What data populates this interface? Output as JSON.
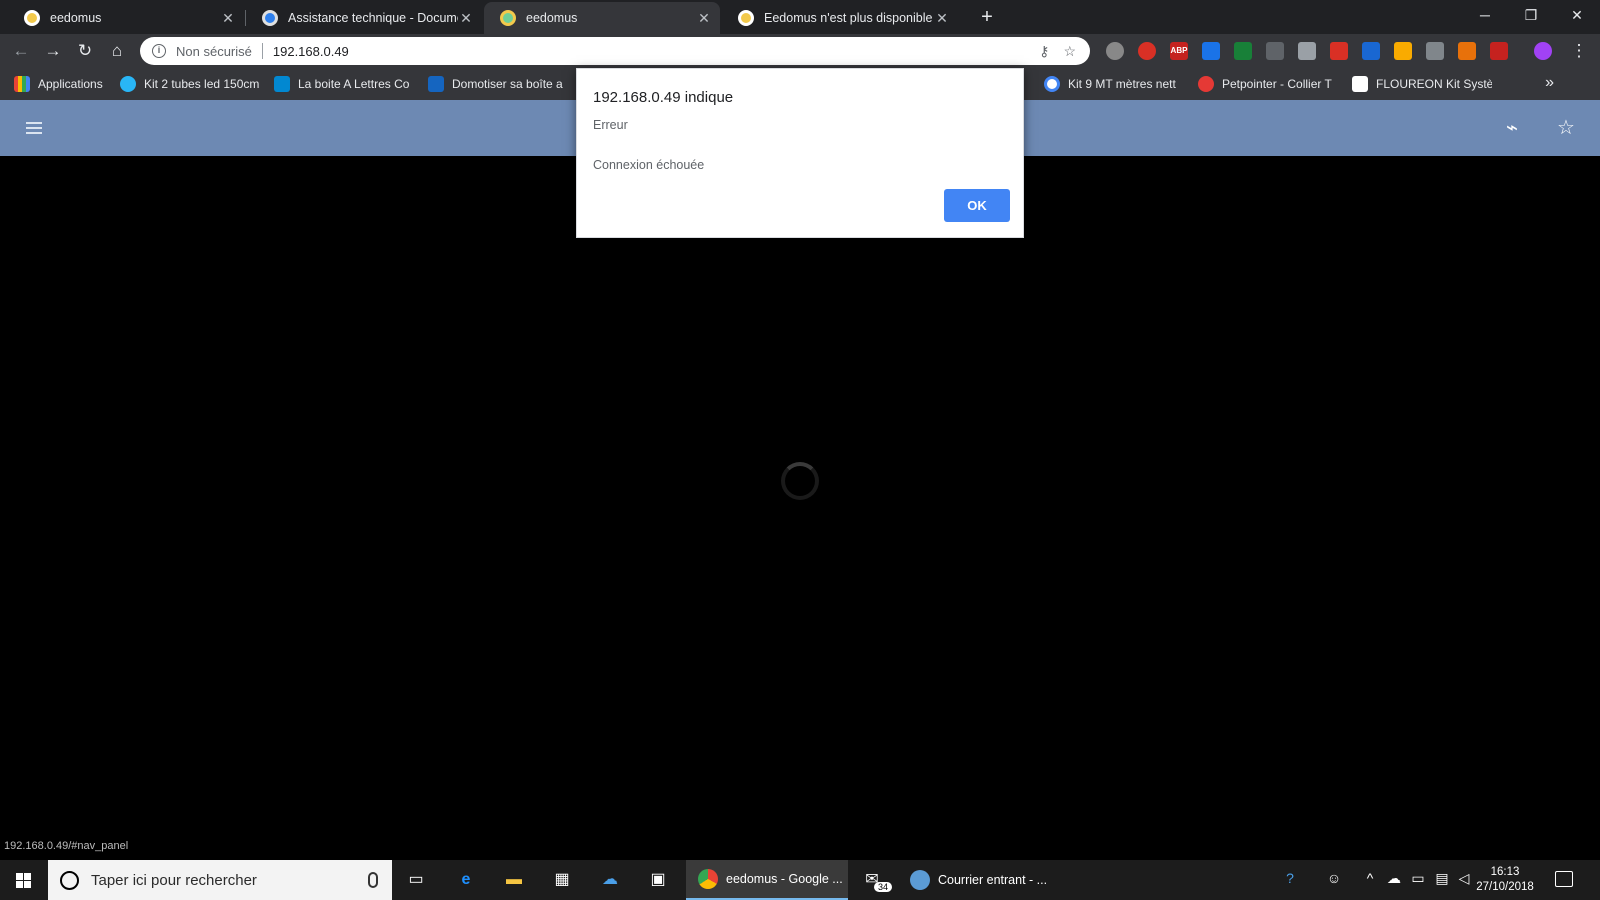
{
  "browser": {
    "tabs": [
      {
        "title": "eedomus",
        "active": false
      },
      {
        "title": "Assistance technique - Documen",
        "active": false
      },
      {
        "title": "eedomus",
        "active": true
      },
      {
        "title": "Eedomus n'est plus disponible da",
        "active": false
      }
    ],
    "new_tab_label": "+",
    "window_controls": {
      "minimize": "─",
      "restore": "❐",
      "close": "✕"
    },
    "omnibox": {
      "security_text": "Non sécurisé",
      "url": "192.168.0.49"
    },
    "bookmarks": [
      {
        "label": "Applications",
        "icon": "apps-grid-icon"
      },
      {
        "label": "Kit 2 tubes led 150cm",
        "icon": "bookmark-favicon"
      },
      {
        "label": "La boite A Lettres Co",
        "icon": "bookmark-favicon"
      },
      {
        "label": "Domotiser sa boîte a",
        "icon": "bookmark-favicon"
      },
      {
        "label": "Kit 9 MT mètres nett",
        "icon": "google-icon"
      },
      {
        "label": "Petpointer - Collier T",
        "icon": "bookmark-favicon"
      },
      {
        "label": "FLOUREON Kit Systè",
        "icon": "amazon-icon"
      }
    ],
    "status_url": "192.168.0.49/#nav_panel"
  },
  "dialog": {
    "title": "192.168.0.49 indique",
    "message_line1": "Erreur",
    "message_line2": "Connexion échouée",
    "ok_label": "OK"
  },
  "taskbar": {
    "search_placeholder": "Taper ici pour rechercher",
    "windows": [
      {
        "label": "eedomus - Google ...",
        "active": true
      },
      {
        "label": "Courrier entrant - ...",
        "active": false
      }
    ],
    "mail_badge": "34",
    "time": "16:13",
    "date": "27/10/2018"
  },
  "colors": {
    "appbar": "#6d89b3",
    "ok_button": "#4285f4",
    "tab_strip": "#202124",
    "toolbar": "#35363a"
  }
}
